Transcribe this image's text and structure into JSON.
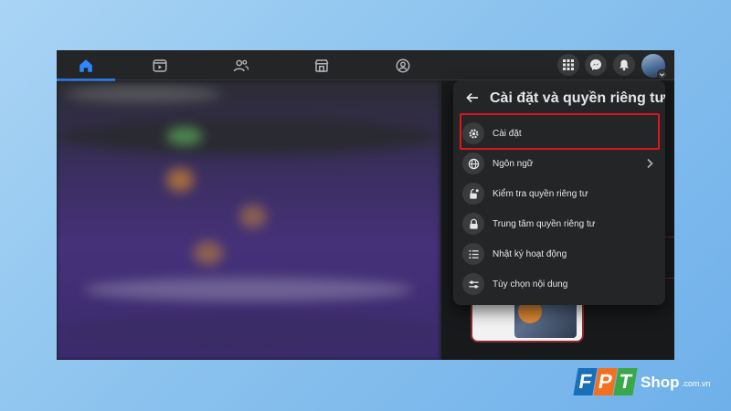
{
  "nav": {
    "tabs": [
      {
        "name": "home",
        "active": true
      },
      {
        "name": "watch",
        "active": false
      },
      {
        "name": "friends",
        "active": false
      },
      {
        "name": "marketplace",
        "active": false
      },
      {
        "name": "groups",
        "active": false
      }
    ],
    "right_buttons": [
      "menu-grid",
      "messenger",
      "notifications",
      "account"
    ]
  },
  "menu": {
    "title": "Cài đặt và quyền riêng tư",
    "items": [
      {
        "label": "Cài đặt",
        "icon": "gear-icon",
        "highlighted": true
      },
      {
        "label": "Ngôn ngữ",
        "icon": "globe-icon",
        "has_submenu": true
      },
      {
        "label": "Kiểm tra quyền riêng tư",
        "icon": "lock-check-icon"
      },
      {
        "label": "Trung tâm quyền riêng tư",
        "icon": "lock-icon"
      },
      {
        "label": "Nhật ký hoạt động",
        "icon": "list-icon"
      },
      {
        "label": "Tùy chọn nội dung",
        "icon": "sliders-icon"
      }
    ]
  },
  "watermark": {
    "letters": [
      "F",
      "P",
      "T"
    ],
    "shop": "Shop",
    "domain": ".com.vn"
  },
  "colors": {
    "accent": "#2d88ff",
    "highlight": "#e0141d",
    "fpt_blue": "#1a6fb9",
    "fpt_orange": "#f37021",
    "fpt_green": "#3aa84a"
  }
}
